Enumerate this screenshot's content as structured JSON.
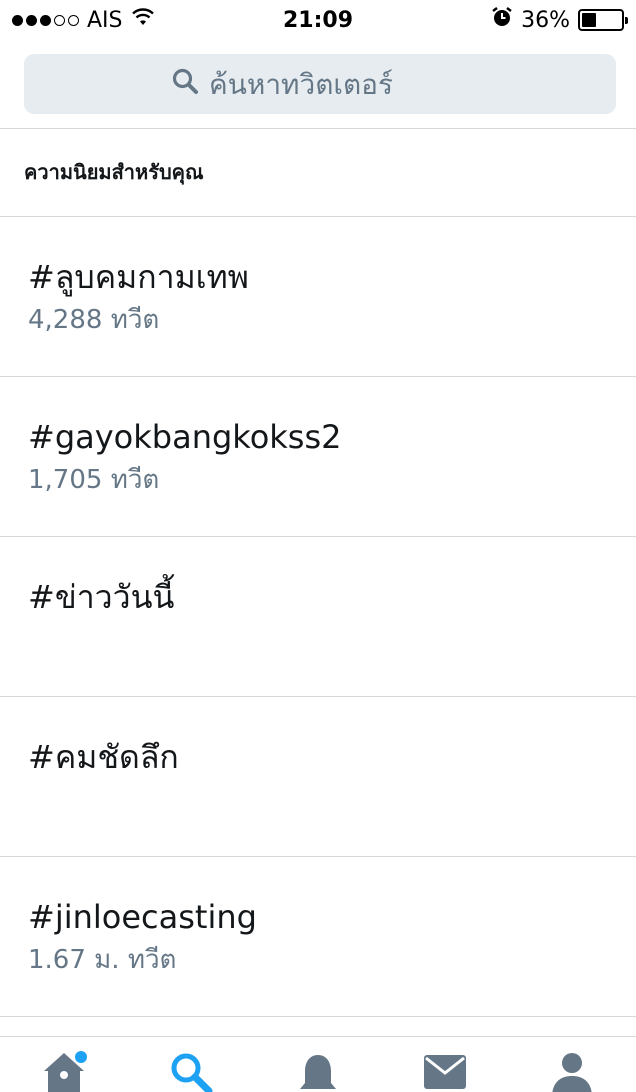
{
  "status_bar": {
    "carrier": "AIS",
    "time": "21:09",
    "battery_percent": "36%",
    "battery_level": 0.36,
    "signal_bars_filled": 3,
    "signal_bars_total": 5
  },
  "search": {
    "placeholder": "ค้นหาทวิตเตอร์",
    "icon": "search-icon"
  },
  "section": {
    "title": "ความนิยมสำหรับคุณ"
  },
  "trends": [
    {
      "name": "#ลูบคมกามเทพ",
      "count": "4,288 ทวีต"
    },
    {
      "name": "#gayokbangkokss2",
      "count": "1,705 ทวีต"
    },
    {
      "name": "#ข่าววันนี้",
      "count": ""
    },
    {
      "name": "#คมชัดลึก",
      "count": ""
    },
    {
      "name": "#jinloecasting",
      "count": "1.67 ม. ทวีต"
    }
  ],
  "tab_bar": {
    "tabs": [
      {
        "icon": "home-icon",
        "active": false,
        "has_badge": true
      },
      {
        "icon": "search-icon",
        "active": true,
        "has_badge": false
      },
      {
        "icon": "bell-icon",
        "active": false,
        "has_badge": false
      },
      {
        "icon": "mail-icon",
        "active": false,
        "has_badge": false
      },
      {
        "icon": "profile-icon",
        "active": false,
        "has_badge": false
      }
    ]
  },
  "colors": {
    "accent": "#1da1f2",
    "secondary_text": "#657786",
    "inactive_icon": "#657786",
    "search_bg": "#e6ecf0",
    "divider": "#d8d8d8"
  }
}
